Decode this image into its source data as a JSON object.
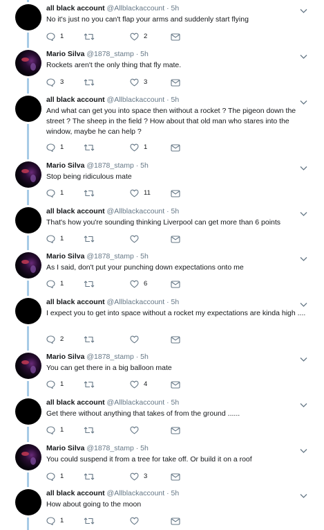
{
  "users": {
    "allblack": {
      "name": "all black account",
      "handle": "@Allblackaccount",
      "avatar": "black-circle"
    },
    "mario": {
      "name": "Mario Silva",
      "handle": "@1878_stamp",
      "avatar": "space-photo"
    }
  },
  "icons": {
    "reply": "reply-icon",
    "retweet": "retweet-icon",
    "like": "heart-icon",
    "dm": "envelope-icon",
    "menu": "chevron-down-icon"
  },
  "colors": {
    "thread_line": "#a7cbe6",
    "secondary_text": "#657786",
    "icon": "#657786"
  },
  "tweets": [
    {
      "name": "all black account",
      "handle": "@Allblackaccount",
      "dot": "·",
      "time": "5h",
      "text": "No it's just no you can't flap your arms and suddenly start flying",
      "replies": "1",
      "retweets": "",
      "likes": "2"
    },
    {
      "name": "Mario Silva",
      "handle": "@1878_stamp",
      "dot": "·",
      "time": "5h",
      "text": "Rockets aren't the only thing that fly mate.",
      "replies": "3",
      "retweets": "",
      "likes": "3"
    },
    {
      "name": "all black account",
      "handle": "@Allblackaccount",
      "dot": "·",
      "time": "5h",
      "text": "And what can get you into space then without a rocket ? The pigeon down the street ? The sheep in the field ? How about that old man who stares into the window, maybe he can help ?",
      "replies": "1",
      "retweets": "",
      "likes": "1"
    },
    {
      "name": "Mario Silva",
      "handle": "@1878_stamp",
      "dot": "·",
      "time": "5h",
      "text": "Stop being ridiculous mate",
      "replies": "1",
      "retweets": "",
      "likes": "11"
    },
    {
      "name": "all black account",
      "handle": "@Allblackaccount",
      "dot": "·",
      "time": "5h",
      "text": "That's how you're sounding thinking Liverpool can get more than 6 points",
      "replies": "1",
      "retweets": "",
      "likes": ""
    },
    {
      "name": "Mario Silva",
      "handle": "@1878_stamp",
      "dot": "·",
      "time": "5h",
      "text": "As I said, don't put your punching down expectations onto me",
      "replies": "1",
      "retweets": "",
      "likes": "6"
    },
    {
      "name": "all black account",
      "handle": "@Allblackaccount",
      "dot": "·",
      "time": "5h",
      "text": "I expect you to get into space without a rocket my expectations are kinda high ....",
      "replies": "2",
      "retweets": "",
      "likes": ""
    },
    {
      "name": "Mario Silva",
      "handle": "@1878_stamp",
      "dot": "·",
      "time": "5h",
      "text": "You can get there in a big balloon mate",
      "replies": "1",
      "retweets": "",
      "likes": "4"
    },
    {
      "name": "all black account",
      "handle": "@Allblackaccount",
      "dot": "·",
      "time": "5h",
      "text": "Get there without anything that takes of from the ground ......",
      "replies": "1",
      "retweets": "",
      "likes": ""
    },
    {
      "name": "Mario Silva",
      "handle": "@1878_stamp",
      "dot": "·",
      "time": "5h",
      "text": "You could suspend it from a tree for take off. Or build it on a roof",
      "replies": "1",
      "retweets": "",
      "likes": "3"
    },
    {
      "name": "all black account",
      "handle": "@Allblackaccount",
      "dot": "·",
      "time": "5h",
      "text": "How about going to the moon",
      "replies": "1",
      "retweets": "",
      "likes": ""
    }
  ]
}
